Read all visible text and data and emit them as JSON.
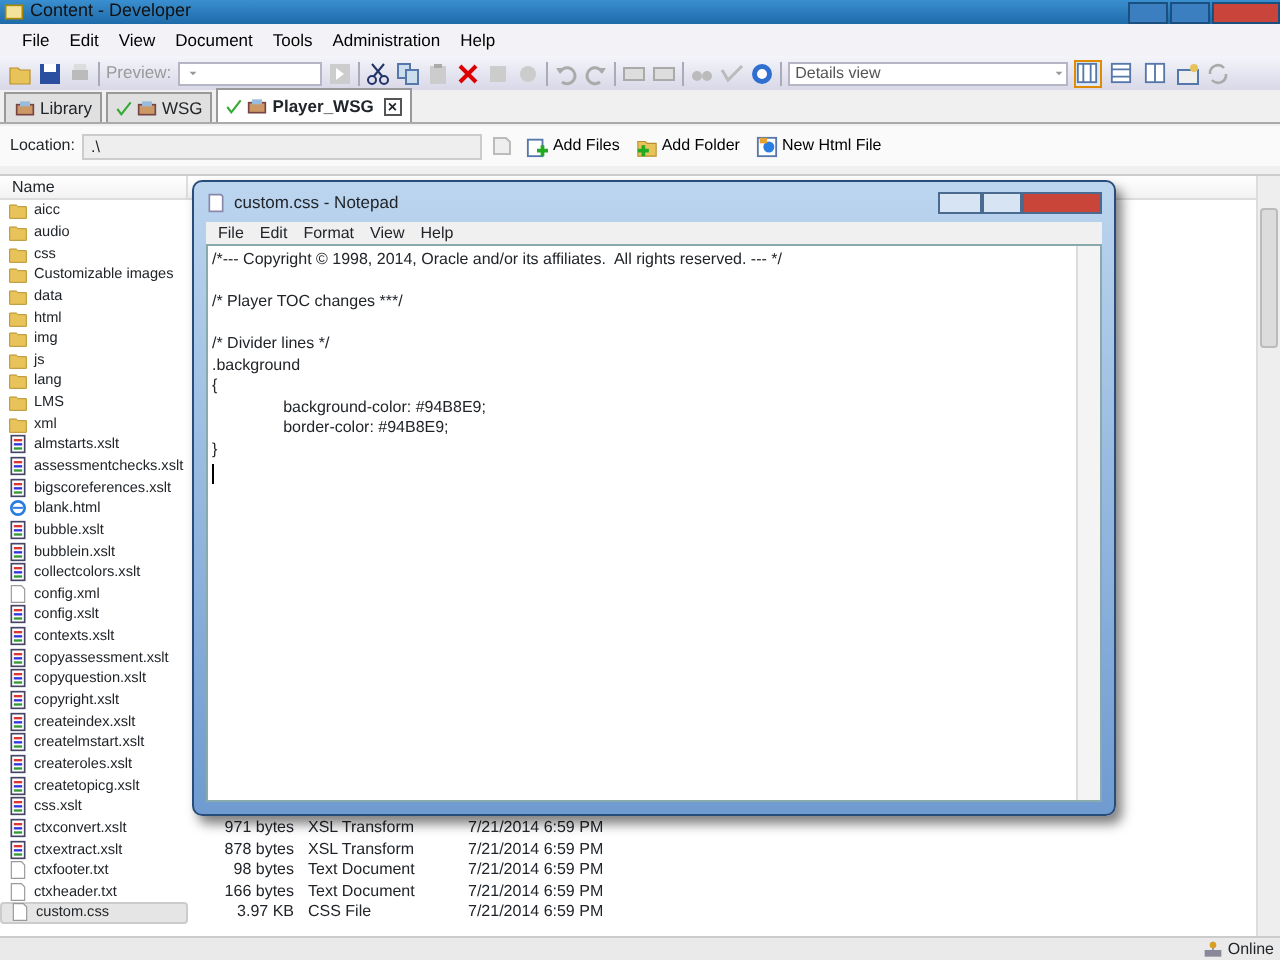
{
  "window": {
    "title": "Content - Developer"
  },
  "menu": [
    "File",
    "Edit",
    "View",
    "Document",
    "Tools",
    "Administration",
    "Help"
  ],
  "toolbar": {
    "preview_label": "Preview:",
    "view_select": "Details view",
    "view_buttons": [
      {
        "selected": true
      },
      {
        "selected": false
      },
      {
        "selected": false
      }
    ]
  },
  "tabs": [
    {
      "label": "Library",
      "selected": false,
      "checked": false
    },
    {
      "label": "WSG",
      "selected": false,
      "checked": true
    },
    {
      "label": "Player_WSG",
      "selected": true,
      "checked": true,
      "close": "×"
    }
  ],
  "location": {
    "label": "Location:",
    "value": ".\\"
  },
  "actions": [
    "Add Files",
    "Add Folder",
    "New Html File"
  ],
  "file_list": {
    "columns": [
      "Name"
    ],
    "rows": [
      {
        "kind": "folder",
        "name": "aicc",
        "selected": false
      },
      {
        "kind": "folder",
        "name": "audio",
        "selected": false
      },
      {
        "kind": "folder",
        "name": "css",
        "selected": false
      },
      {
        "kind": "folder",
        "name": "Customizable images",
        "selected": false
      },
      {
        "kind": "folder",
        "name": "data",
        "selected": false
      },
      {
        "kind": "folder",
        "name": "html",
        "selected": false
      },
      {
        "kind": "folder",
        "name": "img",
        "selected": false
      },
      {
        "kind": "folder",
        "name": "js",
        "selected": false
      },
      {
        "kind": "folder",
        "name": "lang",
        "selected": false
      },
      {
        "kind": "folder",
        "name": "LMS",
        "selected": false
      },
      {
        "kind": "folder",
        "name": "xml",
        "selected": false
      },
      {
        "kind": "xslt",
        "name": "almstarts.xslt",
        "selected": false
      },
      {
        "kind": "xslt",
        "name": "assessmentchecks.xslt",
        "selected": false
      },
      {
        "kind": "xslt",
        "name": "bigscoreferences.xslt",
        "selected": false
      },
      {
        "kind": "html",
        "name": "blank.html",
        "selected": false
      },
      {
        "kind": "xslt",
        "name": "bubble.xslt",
        "selected": false
      },
      {
        "kind": "xslt",
        "name": "bubblein.xslt",
        "selected": false
      },
      {
        "kind": "xslt",
        "name": "collectcolors.xslt",
        "selected": false
      },
      {
        "kind": "doc",
        "name": "config.xml",
        "selected": false
      },
      {
        "kind": "xslt",
        "name": "config.xslt",
        "selected": false
      },
      {
        "kind": "xslt",
        "name": "contexts.xslt",
        "selected": false
      },
      {
        "kind": "xslt",
        "name": "copyassessment.xslt",
        "selected": false
      },
      {
        "kind": "xslt",
        "name": "copyquestion.xslt",
        "selected": false
      },
      {
        "kind": "xslt",
        "name": "copyright.xslt",
        "selected": false
      },
      {
        "kind": "xslt",
        "name": "createindex.xslt",
        "selected": false
      },
      {
        "kind": "xslt",
        "name": "createlmstart.xslt",
        "selected": false
      },
      {
        "kind": "xslt",
        "name": "createroles.xslt",
        "selected": false
      },
      {
        "kind": "xslt",
        "name": "createtopicg.xslt",
        "selected": false
      },
      {
        "kind": "xslt",
        "name": "css.xslt",
        "selected": false
      },
      {
        "kind": "xslt",
        "name": "ctxconvert.xslt",
        "size": "971 bytes",
        "type": "XSL Transform",
        "date": "7/21/2014 6:59 PM",
        "selected": false
      },
      {
        "kind": "xslt",
        "name": "ctxextract.xslt",
        "size": "878 bytes",
        "type": "XSL Transform",
        "date": "7/21/2014 6:59 PM",
        "selected": false
      },
      {
        "kind": "doc",
        "name": "ctxfooter.txt",
        "size": "98 bytes",
        "type": "Text Document",
        "date": "7/21/2014 6:59 PM",
        "selected": false
      },
      {
        "kind": "doc",
        "name": "ctxheader.txt",
        "size": "166 bytes",
        "type": "Text Document",
        "date": "7/21/2014 6:59 PM",
        "selected": false
      },
      {
        "kind": "doc",
        "name": "custom.css",
        "size": "3.97 KB",
        "type": "CSS File",
        "date": "7/21/2014 6:59 PM",
        "selected": true
      }
    ]
  },
  "notepad": {
    "title": "custom.css - Notepad",
    "menu": [
      "File",
      "Edit",
      "Format",
      "View",
      "Help"
    ],
    "text": "/*--- Copyright © 1998, 2014, Oracle and/or its affiliates.  All rights reserved. --- */\n\n/* Player TOC changes ***/\n\n/* Divider lines */\n.background\n{\n\t\tbackground-color: #94B8E9;\n\t\tborder-color: #94B8E9;\n}"
  },
  "status_bar": {
    "connection": "Online"
  }
}
